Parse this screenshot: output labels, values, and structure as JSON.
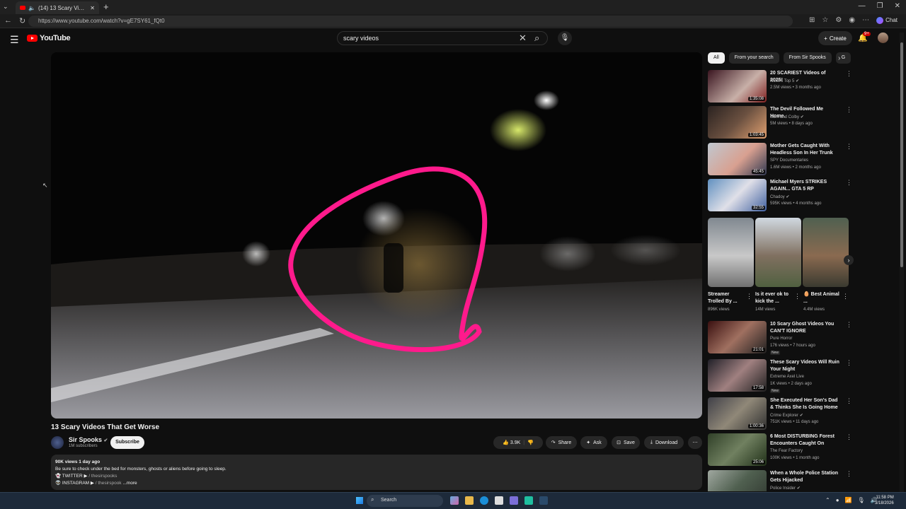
{
  "browser": {
    "tab_title": "(14) 13 Scary Videos That Get Worse",
    "url": "https://www.youtube.com/watch?v=gE7SY61_fQt0",
    "chat_label": "Chat"
  },
  "masthead": {
    "logo_text": "YouTube",
    "search_value": "scary videos",
    "create_label": "Create",
    "notifications_badge": "9+"
  },
  "video": {
    "title": "13 Scary Videos That Get Worse",
    "channel": "Sir Spooks",
    "subscribers": "1M subscribers",
    "subscribe_label": "Subscribe",
    "likes": "3.9K",
    "share_label": "Share",
    "ask_label": "Ask",
    "save_label": "Save",
    "download_label": "Download",
    "views_date": "90K views  1 day ago",
    "description": "Be sure to check under the bed for monsters, ghosts or aliens before going to sleep.",
    "twitter_line": "TWITTER",
    "twitter_handle": "/ thesirspooks",
    "instagram_line": "INSTAGRAM",
    "instagram_handle": "/ thesirspook",
    "more_label": "...more"
  },
  "chips": [
    "All",
    "From your search",
    "From Sir Spooks",
    "G"
  ],
  "recommendations": [
    {
      "title": "20 SCARIEST Videos of 2025!",
      "channel": "Nuke's Top 5",
      "meta": "2.5M views • 3 months ago",
      "duration": "1:35:08",
      "new": false
    },
    {
      "title": "The Devil Followed Me Home.",
      "channel": "Sam and Colby",
      "meta": "5M views • 8 days ago",
      "duration": "1:03:45",
      "new": false
    },
    {
      "title": "Mother Gets Caught With Headless Son In Her Trunk",
      "channel": "SPY Documentaries",
      "meta": "1.6M views • 2 months ago",
      "duration": "45:45",
      "new": false
    },
    {
      "title": "Michael Myers STRIKES AGAIN... GTA 5 RP",
      "channel": "Chadoy",
      "meta": "595K views • 4 months ago",
      "duration": "32:55",
      "new": false
    }
  ],
  "shorts": [
    {
      "title": "Streamer Trolled By ...",
      "views": "896K views"
    },
    {
      "title": "Is it ever ok to kick the ...",
      "views": "14M views"
    },
    {
      "title": "🥚 Best Animal ...",
      "views": "4.4M views"
    }
  ],
  "recommendations2": [
    {
      "title": "10 Scary Ghost Videos You CAN'T IGNORE",
      "channel": "Pure Horror",
      "meta": "176 views • 7 hours ago",
      "duration": "21:01",
      "new": true
    },
    {
      "title": "These Scary Videos Will Ruin Your Night",
      "channel": "Extreme Axel Live",
      "meta": "1K views • 2 days ago",
      "duration": "17:58",
      "new": true
    },
    {
      "title": "She Executed Her Son's Dad & Thinks She Is Going Home",
      "channel": "Crime Explorer",
      "meta": "751K views • 11 days ago",
      "duration": "1:00:36",
      "new": false
    },
    {
      "title": "6 Most DISTURBING Forest Encounters Caught On Camera",
      "channel": "The Fear Factory",
      "meta": "100K views • 1 month ago",
      "duration": "25:06",
      "new": false
    },
    {
      "title": "When a Whole Police Station Gets Hijacked",
      "channel": "Police Insider",
      "meta": "",
      "duration": "",
      "new": false
    }
  ],
  "new_badge": "New",
  "taskbar": {
    "search_placeholder": "Search",
    "time": "11:58 PM",
    "date": "3/18/2026"
  }
}
